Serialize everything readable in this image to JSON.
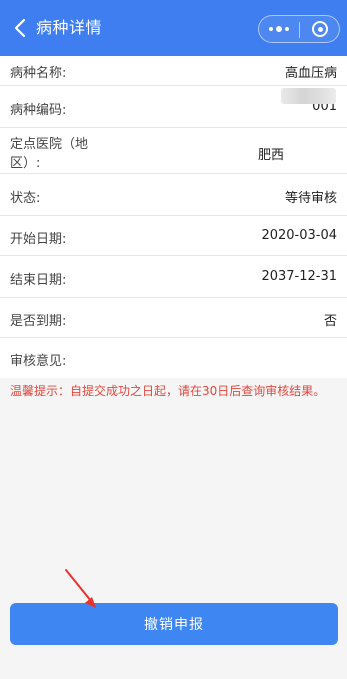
{
  "header": {
    "title": "病种详情",
    "back_icon": "chevron-left-icon",
    "more_icon": "more-dots-icon",
    "close_icon": "target-close-icon",
    "bg_color": "#3e7ef0"
  },
  "fields": [
    {
      "label": "病种名称:",
      "value": "高血压病"
    },
    {
      "label": "病种编码:",
      "value": "001"
    },
    {
      "label_line1": "定点医院（地",
      "label_line2": "区）:",
      "value": "肥西"
    },
    {
      "label": "状态:",
      "value": "等待审核"
    },
    {
      "label": "开始日期:",
      "value": "2020-03-04"
    },
    {
      "label": "结束日期:",
      "value": "2037-12-31"
    },
    {
      "label": "是否到期:",
      "value": "否"
    },
    {
      "label": "审核意见:",
      "value": ""
    }
  ],
  "tip": "温馨提示：自提交成功之日起，请在30日后查询审核结果。",
  "tip_color": "#e0483f",
  "submit": {
    "label": "撤销申报",
    "color": "#3e86f2"
  },
  "annotation": {
    "arrow_color": "#e8322b"
  }
}
